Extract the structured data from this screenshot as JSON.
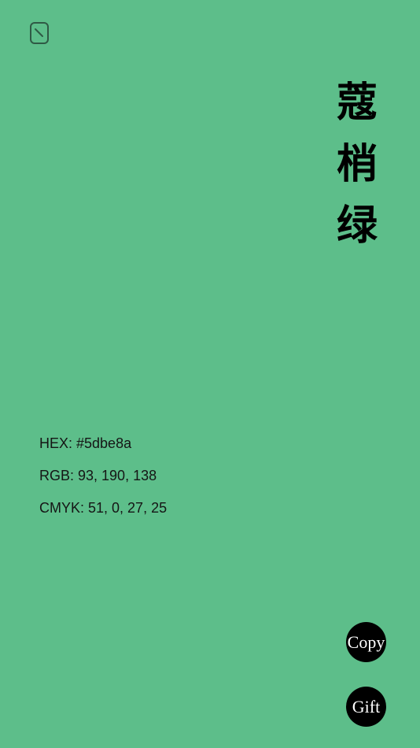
{
  "colors": {
    "background": "#5dbe8a",
    "button_bg": "#000000",
    "button_text": "#ffffff"
  },
  "back_icon": "back-icon",
  "color_name": [
    "蔻",
    "梢",
    "绿"
  ],
  "info": {
    "hex": "HEX: #5dbe8a",
    "rgb": "RGB: 93, 190, 138",
    "cmyk": "CMYK: 51, 0, 27, 25"
  },
  "buttons": {
    "copy": "Copy",
    "gift": "Gift"
  }
}
